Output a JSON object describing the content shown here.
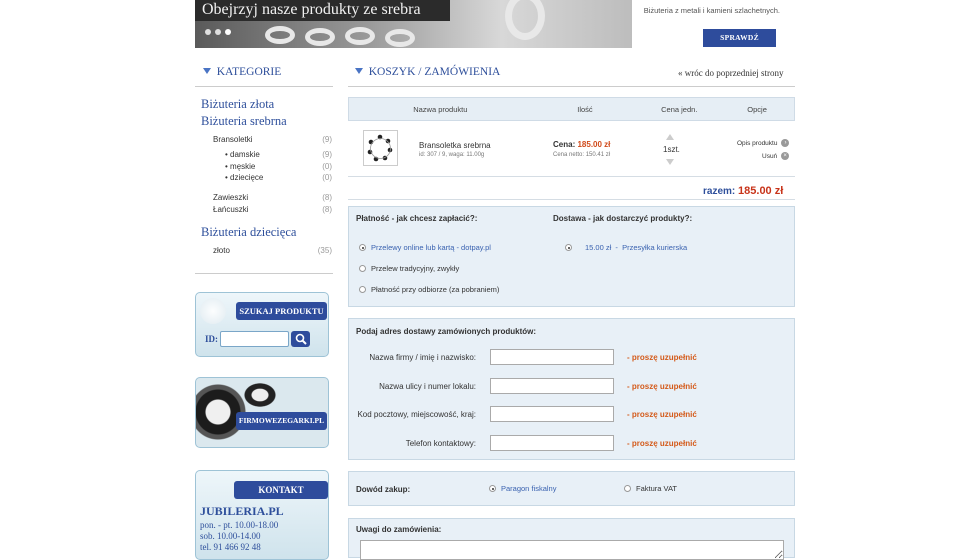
{
  "banner": {
    "title": "Obejrzyj nasze produkty ze srebra",
    "right_text": "Biżuteria z metali i kamieni szlachetnych.",
    "button": "SPRAWDŹ"
  },
  "sidebar": {
    "categories_heading": "KATEGORIE",
    "groups": [
      {
        "label": "Biżuteria złota",
        "items": []
      },
      {
        "label": "Biżuteria srebrna",
        "items": [
          {
            "label": "Bransoletki",
            "count": "(9)"
          },
          {
            "label": "damskie",
            "count": "(9)",
            "level": 2
          },
          {
            "label": "męskie",
            "count": "(0)",
            "level": 2
          },
          {
            "label": "dziecięce",
            "count": "(0)",
            "level": 2
          },
          {
            "label": "Zawieszki",
            "count": "(8)"
          },
          {
            "label": "Łańcuszki",
            "count": "(8)"
          }
        ]
      },
      {
        "label": "Biżuteria dziecięca",
        "items": [
          {
            "label": "złoto",
            "count": "(35)"
          }
        ]
      }
    ],
    "search": {
      "label": "SZUKAJ PRODUKTU",
      "id_label": "ID:"
    },
    "watch_label": "FIRMOWEZEGARKI.PL",
    "contact": {
      "label": "KONTAKT",
      "name": "JUBILERIA.PL",
      "lines": [
        "pon. - pt. 10.00-18.00",
        "sob. 10.00-14.00",
        "tel. 91 466 92 48"
      ]
    }
  },
  "cart": {
    "heading": "KOSZYK / ZAMÓWIENIA",
    "back_link": "« wróc do poprzedniej strony",
    "columns": [
      "Nazwa produktu",
      "Ilość",
      "Cena jedn.",
      "Opcje"
    ],
    "item": {
      "name": "Bransoletka srebrna",
      "meta": "id: 307 / 9, waga: 11.00g",
      "price_label": "Cena:",
      "price": "185.00 zł",
      "netto": "Cena netto: 150.41 zł",
      "qty": "1szt.",
      "opt_desc": "Opis produktu",
      "opt_remove": "Usuń"
    },
    "total_label": "razem:",
    "total": "185.00 zł"
  },
  "payment": {
    "title": "Płatność - jak chcesz zapłacić?:",
    "options": [
      "Przelewy online lub kartą - dotpay.pl",
      "Przelew tradycyjny, zwykły",
      "Płatność przy odbiorze (za pobraniem)"
    ],
    "selected": 0
  },
  "delivery": {
    "title": "Dostawa - jak dostarczyć produkty?:",
    "option": "15.00 zł  -  Przesyłka kurierska"
  },
  "address": {
    "title": "Podaj adres dostawy zamówionych produktów:",
    "fields": [
      "Nazwa firmy / imię i nazwisko:",
      "Nazwa ulicy i numer lokalu:",
      "Kod pocztowy, miejscowość, kraj:",
      "Telefon kontaktowy:"
    ],
    "required": "- proszę uzupełnić"
  },
  "proof": {
    "title": "Dowód zakup:",
    "options": [
      "Paragon fiskalny",
      "Faktura VAT"
    ],
    "selected": 0
  },
  "notes": {
    "title": "Uwagi do zamówienia:"
  }
}
